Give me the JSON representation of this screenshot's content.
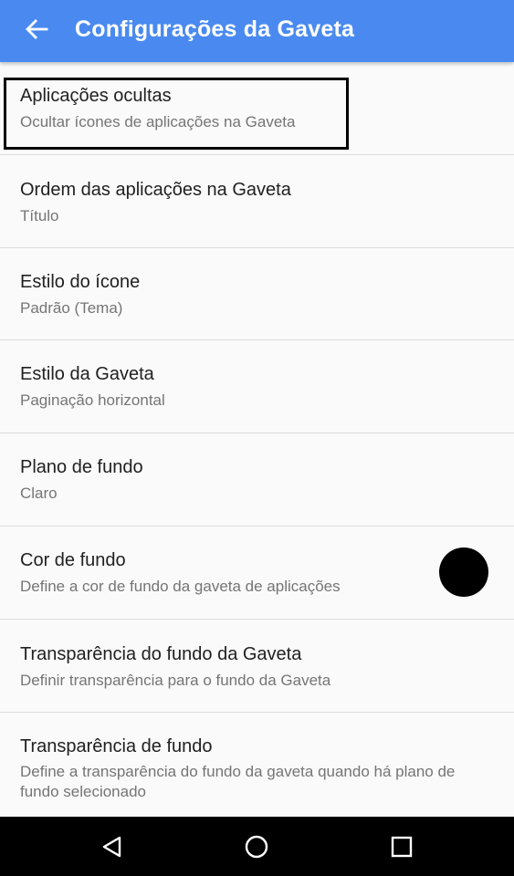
{
  "app_bar": {
    "title": "Configurações da Gaveta",
    "back_icon": "arrow-back-icon",
    "color": "#4a8af0"
  },
  "settings": {
    "items": [
      {
        "title": "Aplicações ocultas",
        "subtitle": "Ocultar ícones de aplicações na Gaveta",
        "highlighted": true
      },
      {
        "title": "Ordem das aplicações na Gaveta",
        "subtitle": "Título"
      },
      {
        "title": "Estilo do ícone",
        "subtitle": "Padrão (Tema)"
      },
      {
        "title": "Estilo da Gaveta",
        "subtitle": "Paginação horizontal"
      },
      {
        "title": "Plano de fundo",
        "subtitle": "Claro"
      },
      {
        "title": "Cor de fundo",
        "subtitle": "Define a cor de fundo da gaveta de aplicações",
        "swatch_color": "#000000"
      },
      {
        "title": "Transparência do fundo da Gaveta",
        "subtitle": "Definir transparência para o fundo da Gaveta"
      },
      {
        "title": "Transparência de fundo",
        "subtitle": "Define a transparência do fundo da gaveta quando há plano de fundo selecionado"
      }
    ]
  },
  "nav_bar": {
    "icons": [
      "back-triangle-icon",
      "home-circle-icon",
      "recents-square-icon"
    ]
  }
}
